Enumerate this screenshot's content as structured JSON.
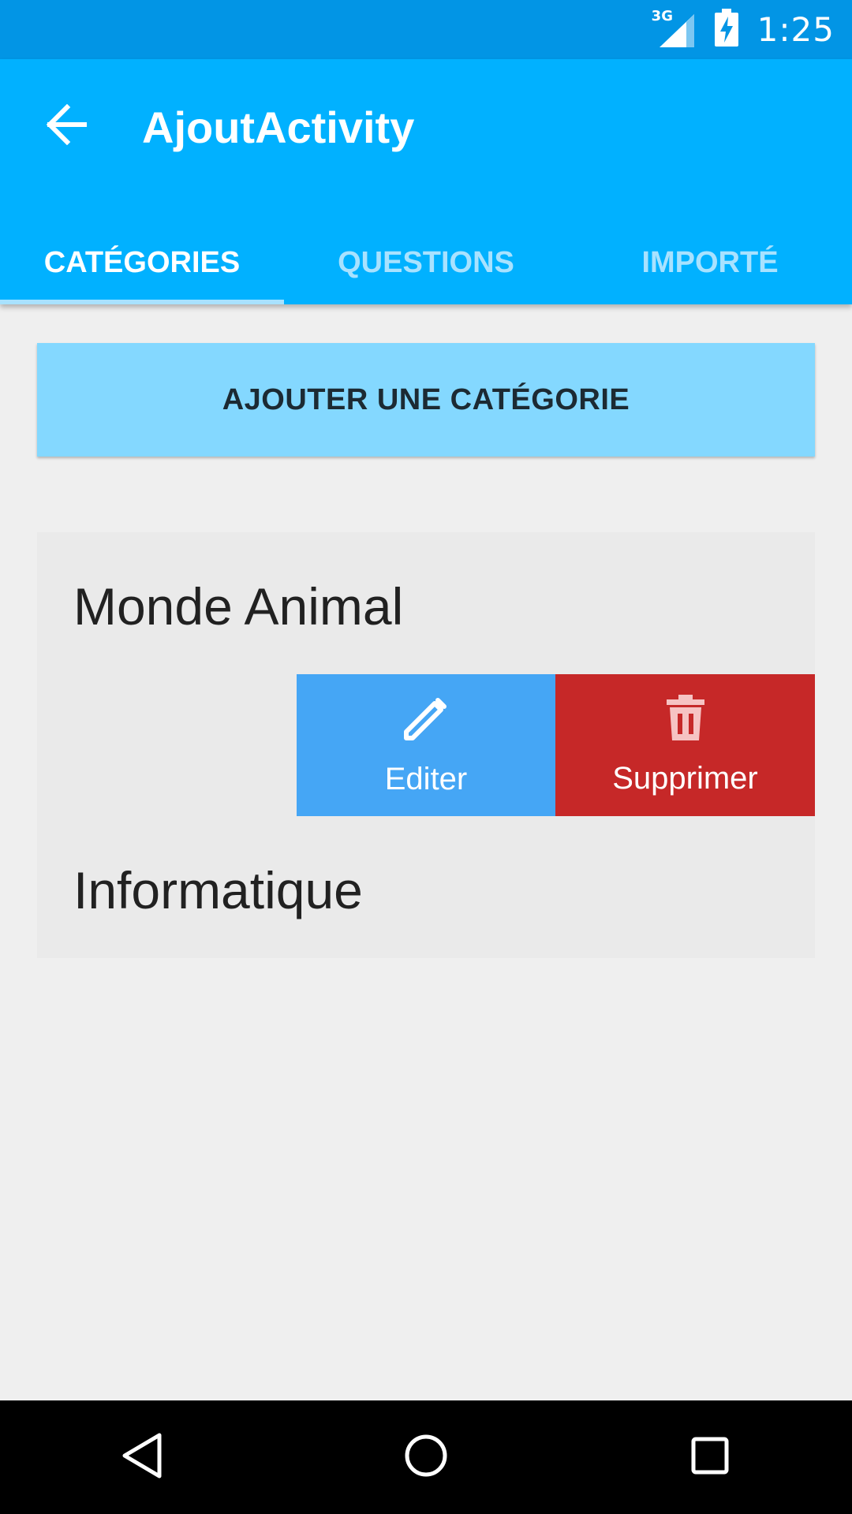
{
  "status_bar": {
    "network_label": "3G",
    "time": "1:25"
  },
  "app_bar": {
    "title": "AjoutActivity",
    "back_icon": "arrow-back-icon"
  },
  "tabs": [
    {
      "label": "CATÉGORIES",
      "active": true
    },
    {
      "label": "QUESTIONS",
      "active": false
    },
    {
      "label": "IMPORTÉ",
      "active": false
    }
  ],
  "add_button": {
    "label": "AJOUTER UNE CATÉGORIE"
  },
  "categories": [
    {
      "name": "Monde Animal"
    },
    {
      "name": "Informatique"
    }
  ],
  "swipe_actions": {
    "edit_label": "Editer",
    "edit_icon": "pencil-icon",
    "delete_label": "Supprimer",
    "delete_icon": "trash-icon"
  },
  "colors": {
    "status_bar": "#0295e5",
    "app_bar": "#01b1ff",
    "add_button": "#84d8ff",
    "edit": "#45a6f5",
    "delete": "#c62828"
  },
  "nav_bar": {
    "back_icon": "nav-back-icon",
    "home_icon": "nav-home-icon",
    "recents_icon": "nav-recents-icon"
  }
}
